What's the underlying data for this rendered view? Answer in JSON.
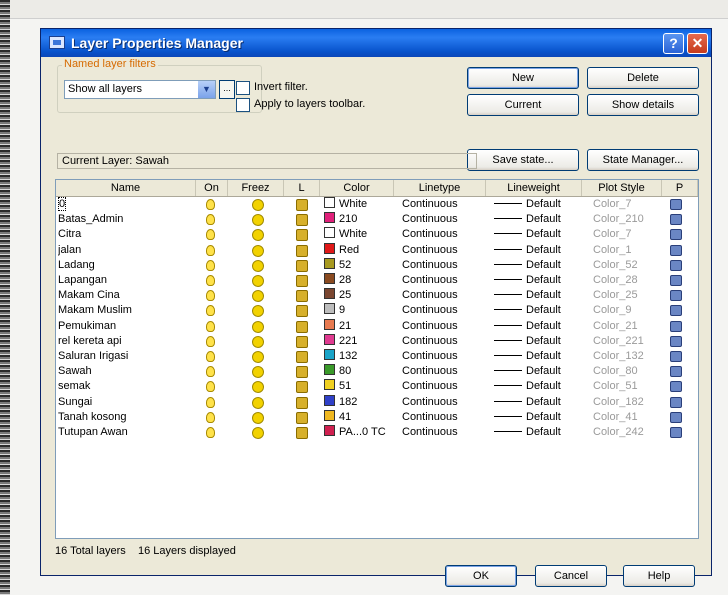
{
  "dialog": {
    "title": "Layer Properties Manager",
    "help_icon": "help-icon",
    "close_icon": "close-icon"
  },
  "filters": {
    "group_label": "Named layer filters",
    "selected": "Show all layers",
    "browse_label": "...",
    "invert_label": "Invert filter.",
    "apply_label": "Apply to layers toolbar."
  },
  "buttons": {
    "new": "New",
    "delete": "Delete",
    "current": "Current",
    "show_details": "Show details",
    "save_state": "Save state...",
    "state_manager": "State Manager...",
    "ok": "OK",
    "cancel": "Cancel",
    "help": "Help"
  },
  "current_layer": "Current Layer: Sawah",
  "table": {
    "headers": [
      "Name",
      "On",
      "Freez",
      "L",
      "Color",
      "Linetype",
      "Lineweight",
      "Plot Style",
      "P"
    ],
    "rows": [
      {
        "name": "0",
        "color": "White",
        "swatch": "#ffffff",
        "linetype": "Continuous",
        "lineweight": "Default",
        "plot_style": "Color_7"
      },
      {
        "name": "Batas_Admin",
        "color": "210",
        "swatch": "#e0207a",
        "linetype": "Continuous",
        "lineweight": "Default",
        "plot_style": "Color_210"
      },
      {
        "name": "Citra",
        "color": "White",
        "swatch": "#ffffff",
        "linetype": "Continuous",
        "lineweight": "Default",
        "plot_style": "Color_7"
      },
      {
        "name": "jalan",
        "color": "Red",
        "swatch": "#e01818",
        "linetype": "Continuous",
        "lineweight": "Default",
        "plot_style": "Color_1"
      },
      {
        "name": "Ladang",
        "color": "52",
        "swatch": "#a89a20",
        "linetype": "Continuous",
        "lineweight": "Default",
        "plot_style": "Color_52"
      },
      {
        "name": "Lapangan",
        "color": "28",
        "swatch": "#8a4a20",
        "linetype": "Continuous",
        "lineweight": "Default",
        "plot_style": "Color_28"
      },
      {
        "name": "Makam Cina",
        "color": "25",
        "swatch": "#7a4630",
        "linetype": "Continuous",
        "lineweight": "Default",
        "plot_style": "Color_25"
      },
      {
        "name": "Makam Muslim",
        "color": "9",
        "swatch": "#bdbdbd",
        "linetype": "Continuous",
        "lineweight": "Default",
        "plot_style": "Color_9"
      },
      {
        "name": "Pemukiman",
        "color": "21",
        "swatch": "#e87a50",
        "linetype": "Continuous",
        "lineweight": "Default",
        "plot_style": "Color_21"
      },
      {
        "name": "rel kereta api",
        "color": "221",
        "swatch": "#e03a90",
        "linetype": "Continuous",
        "lineweight": "Default",
        "plot_style": "Color_221"
      },
      {
        "name": "Saluran Irigasi",
        "color": "132",
        "swatch": "#1aa4c8",
        "linetype": "Continuous",
        "lineweight": "Default",
        "plot_style": "Color_132"
      },
      {
        "name": "Sawah",
        "color": "80",
        "swatch": "#3a9a2a",
        "linetype": "Continuous",
        "lineweight": "Default",
        "plot_style": "Color_80"
      },
      {
        "name": "semak",
        "color": "51",
        "swatch": "#f0d020",
        "linetype": "Continuous",
        "lineweight": "Default",
        "plot_style": "Color_51"
      },
      {
        "name": "Sungai",
        "color": "182",
        "swatch": "#3040c8",
        "linetype": "Continuous",
        "lineweight": "Default",
        "plot_style": "Color_182"
      },
      {
        "name": "Tanah kosong",
        "color": "41",
        "swatch": "#f0b820",
        "linetype": "Continuous",
        "lineweight": "Default",
        "plot_style": "Color_41"
      },
      {
        "name": "Tutupan Awan",
        "color": "PA...0 TC",
        "swatch": "#d02050",
        "linetype": "Continuous",
        "lineweight": "Default",
        "plot_style": "Color_242"
      }
    ]
  },
  "status": {
    "total": "16 Total layers",
    "displayed": "16 Layers displayed"
  }
}
